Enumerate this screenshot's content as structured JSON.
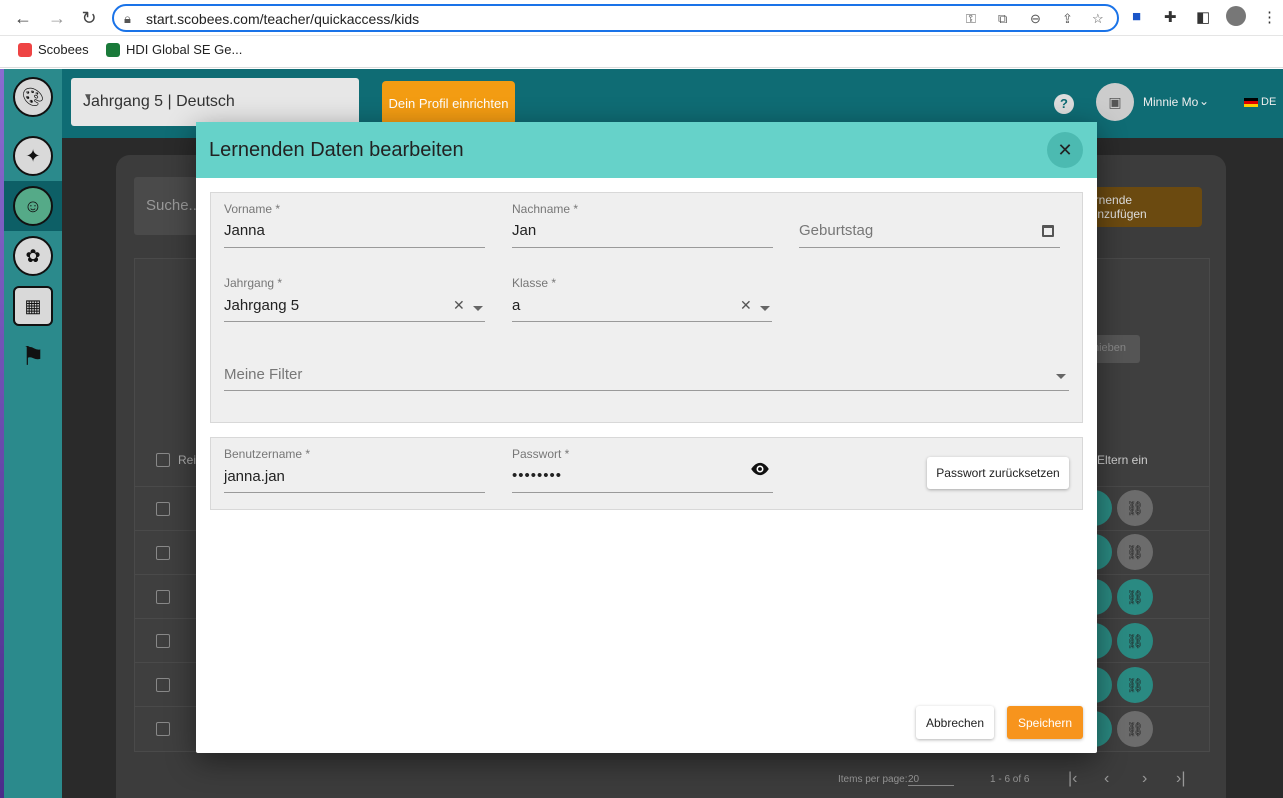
{
  "browser": {
    "url": "start.scobees.com/teacher/quickaccess/kids",
    "bookmarks": [
      {
        "label": "Scobees"
      },
      {
        "label": "HDI Global SE Ge..."
      }
    ]
  },
  "header": {
    "course_select": "Jahrgang 5 | Deutsch",
    "profile_button": "Dein Profil einrichten",
    "help_label": "?",
    "user_name": "Minnie Mo",
    "language": "DE"
  },
  "background": {
    "search_placeholder": "Suche...",
    "add_button": "ernende hinzufügen",
    "faded_button": "hieben",
    "col_select": "Reih",
    "col_parents": "Eltern ein",
    "items_per_page_label": "Items per page:",
    "items_per_page": "20",
    "range": "1 - 6 of 6"
  },
  "modal": {
    "title": "Lernenden Daten bearbeiten",
    "fields": {
      "vorname": {
        "label": "Vorname *",
        "value": "Janna"
      },
      "nachname": {
        "label": "Nachname *",
        "value": "Jan"
      },
      "geburtstag": {
        "placeholder": "Geburtstag"
      },
      "jahrgang": {
        "label": "Jahrgang *",
        "value": "Jahrgang 5"
      },
      "klasse": {
        "label": "Klasse *",
        "value": "a"
      },
      "filter": {
        "placeholder": "Meine Filter"
      },
      "benutzername": {
        "label": "Benutzername *",
        "value": "janna.jan"
      },
      "passwort": {
        "label": "Passwort *",
        "value": "••••••••"
      }
    },
    "reset_password_button": "Passwort zurücksetzen",
    "cancel_button": "Abbrechen",
    "save_button": "Speichern"
  },
  "colors": {
    "modal_header": "#66d2c9",
    "save_button": "#f7941d",
    "topbar": "#0f6c74"
  }
}
